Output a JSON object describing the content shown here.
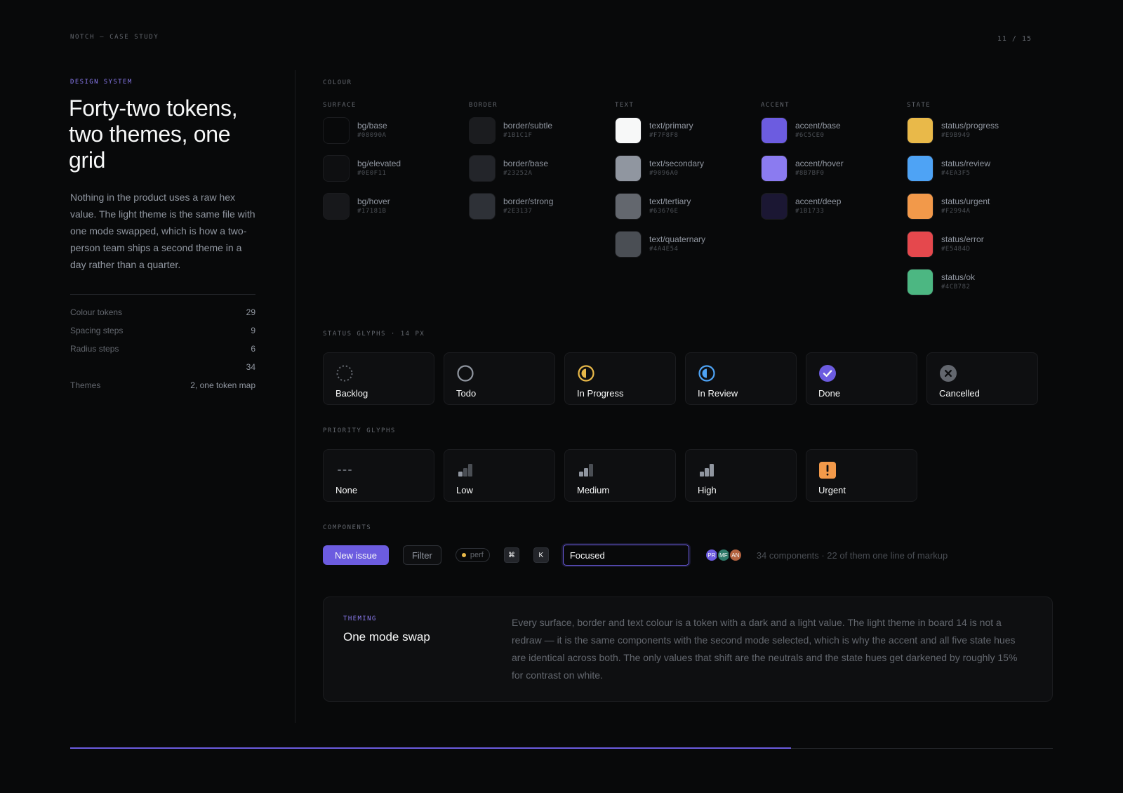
{
  "header": {
    "kicker": "NOTCH — CASE STUDY",
    "page_indicator": "11 / 15"
  },
  "left": {
    "eyebrow": "DESIGN SYSTEM",
    "title": "Forty-two tokens, two themes, one grid",
    "intro": "Nothing in the product uses a raw hex value. The light theme is the same file with one mode swapped, which is how a two-person team ships a second theme in a day rather than a quarter.",
    "stats": [
      {
        "label": "Colour tokens",
        "value": "29"
      },
      {
        "label": "Spacing steps",
        "value": "9"
      },
      {
        "label": "Radius steps",
        "value": "6"
      },
      {
        "label": "",
        "value": "34"
      },
      {
        "label": "Themes",
        "value": "2, one token map"
      }
    ]
  },
  "colour": {
    "label": "COLOUR",
    "groups": [
      {
        "name": "SURFACE",
        "tokens": [
          {
            "name": "bg/base",
            "hex": "#08090A",
            "color": "#08090A"
          },
          {
            "name": "bg/elevated",
            "hex": "#0E0F11",
            "color": "#0E0F11"
          },
          {
            "name": "bg/hover",
            "hex": "#17181B",
            "color": "#17181B"
          }
        ]
      },
      {
        "name": "BORDER",
        "tokens": [
          {
            "name": "border/subtle",
            "hex": "#1B1C1F",
            "color": "#1B1C1F"
          },
          {
            "name": "border/base",
            "hex": "#23252A",
            "color": "#23252A"
          },
          {
            "name": "border/strong",
            "hex": "#2E3137",
            "color": "#2E3137"
          }
        ]
      },
      {
        "name": "TEXT",
        "tokens": [
          {
            "name": "text/primary",
            "hex": "#F7F8F8",
            "color": "#F7F8F8"
          },
          {
            "name": "text/secondary",
            "hex": "#9096A0",
            "color": "#9096A0"
          },
          {
            "name": "text/tertiary",
            "hex": "#63676E",
            "color": "#63676E"
          },
          {
            "name": "text/quaternary",
            "hex": "#4A4E54",
            "color": "#4A4E54"
          }
        ]
      },
      {
        "name": "ACCENT",
        "tokens": [
          {
            "name": "accent/base",
            "hex": "#6C5CE0",
            "color": "#6C5CE0"
          },
          {
            "name": "accent/hover",
            "hex": "#8B7BF0",
            "color": "#8B7BF0"
          },
          {
            "name": "accent/deep",
            "hex": "#1B1733",
            "color": "#1B1733"
          }
        ]
      },
      {
        "name": "STATE",
        "tokens": [
          {
            "name": "status/progress",
            "hex": "#E9B949",
            "color": "#E9B949"
          },
          {
            "name": "status/review",
            "hex": "#4EA3F5",
            "color": "#4EA3F5"
          },
          {
            "name": "status/urgent",
            "hex": "#F2994A",
            "color": "#F2994A"
          },
          {
            "name": "status/error",
            "hex": "#E5484D",
            "color": "#E5484D"
          },
          {
            "name": "status/ok",
            "hex": "#4CB782",
            "color": "#4CB782"
          }
        ]
      }
    ]
  },
  "status_glyphs": {
    "label": "STATUS GLYPHS · 14 PX",
    "items": [
      {
        "label": "Backlog",
        "icon": "backlog-dashed-circle-icon"
      },
      {
        "label": "Todo",
        "icon": "todo-circle-icon"
      },
      {
        "label": "In Progress",
        "icon": "in-progress-half-circle-icon"
      },
      {
        "label": "In Review",
        "icon": "in-review-half-circle-icon"
      },
      {
        "label": "Done",
        "icon": "done-check-circle-icon"
      },
      {
        "label": "Cancelled",
        "icon": "cancelled-x-circle-icon"
      }
    ]
  },
  "priority_glyphs": {
    "label": "PRIORITY GLYPHS",
    "items": [
      {
        "label": "None",
        "icon": "priority-none-icon",
        "level": 0
      },
      {
        "label": "Low",
        "icon": "priority-low-icon",
        "level": 1
      },
      {
        "label": "Medium",
        "icon": "priority-medium-icon",
        "level": 2
      },
      {
        "label": "High",
        "icon": "priority-high-icon",
        "level": 3
      },
      {
        "label": "Urgent",
        "icon": "priority-urgent-icon",
        "level": 4
      }
    ]
  },
  "components": {
    "label": "COMPONENTS",
    "primary_button": "New issue",
    "secondary_button": "Filter",
    "label_pill": "perf",
    "kbd_1": "⌘",
    "kbd_2": "K",
    "input_value": "Focused",
    "avatars": [
      {
        "initials": "PR",
        "color": "#6C5CE0"
      },
      {
        "initials": "MF",
        "color": "#2F7A6A"
      },
      {
        "initials": "AN",
        "color": "#B2623F"
      }
    ],
    "caption": "34 components · 22 of them one line of markup"
  },
  "theming": {
    "eyebrow": "THEMING",
    "title": "One mode swap",
    "body": "Every surface, border and text colour is a token with a dark and a light value. The light theme in board 14 is not a redraw — it is the same components with the second mode selected, which is why the accent and all five state hues are identical across both. The only values that shift are the neutrals and the state hues get darkened by roughly 15% for contrast on white."
  },
  "deck_progress": {
    "fraction": 0.7333
  },
  "colors": {
    "accent": "#6C5CE0",
    "progress": "#E9B949",
    "review": "#4EA3F5",
    "urgent": "#F2994A",
    "cancelled": "#63676E"
  }
}
